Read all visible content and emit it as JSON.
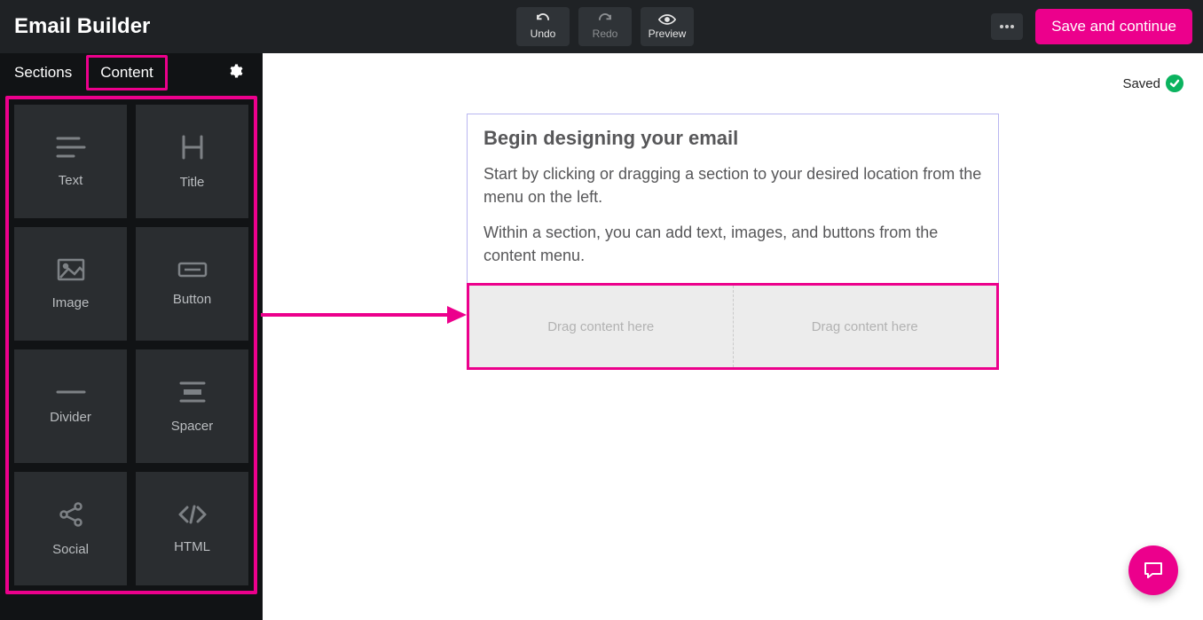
{
  "header": {
    "title": "Email Builder",
    "undo": "Undo",
    "redo": "Redo",
    "preview": "Preview",
    "save": "Save and continue"
  },
  "sidebar": {
    "tabs": {
      "sections": "Sections",
      "content": "Content"
    },
    "tiles": {
      "text": "Text",
      "title": "Title",
      "image": "Image",
      "button": "Button",
      "divider": "Divider",
      "spacer": "Spacer",
      "social": "Social",
      "html": "HTML"
    }
  },
  "status": {
    "saved": "Saved"
  },
  "canvas": {
    "heading": "Begin designing your email",
    "p1": "Start by clicking or dragging a section to your desired location from the menu on the left.",
    "p2": "Within a section, you can add text, images, and buttons from the content menu.",
    "drop1": "Drag content here",
    "drop2": "Drag content here"
  }
}
